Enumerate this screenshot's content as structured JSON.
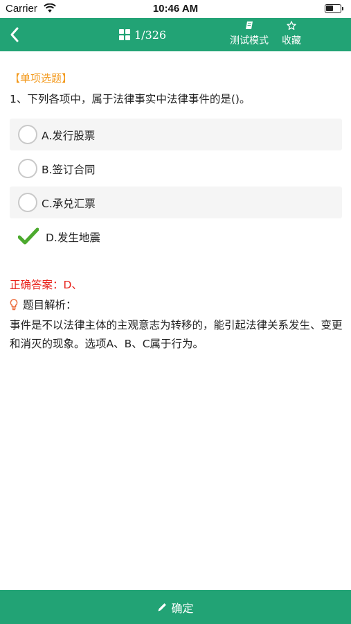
{
  "status_bar": {
    "carrier": "Carrier",
    "time": "10:46 AM"
  },
  "nav": {
    "progress": "1/326",
    "test_mode_label": "测试模式",
    "favorite_label": "收藏",
    "accent_color": "#22a375"
  },
  "question": {
    "type_label": "【单项选题】",
    "text": "1、下列各项中，属于法律事实中法律事件的是()。",
    "options": [
      {
        "label": "A.发行股票",
        "selected": false
      },
      {
        "label": "B.签订合同",
        "selected": false
      },
      {
        "label": "C.承兑汇票",
        "selected": false
      },
      {
        "label": "D.发生地震",
        "selected": true
      }
    ]
  },
  "answer": {
    "correct_text": "正确答案：D、",
    "analysis_title": "题目解析：",
    "analysis_body": "事件是不以法律主体的主观意志为转移的，能引起法律关系发生、变更和消灭的现象。选项A、B、C属于行为。"
  },
  "footer": {
    "confirm_label": "确定"
  }
}
